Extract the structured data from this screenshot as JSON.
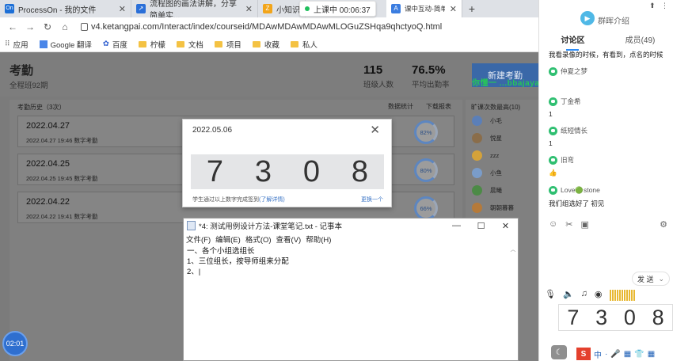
{
  "browser": {
    "tabs": [
      {
        "label": "ProcessOn - 我的文件",
        "fav_color": "#1d6fd6",
        "fav_text": "On"
      },
      {
        "label": "流程图的画法讲解，分享简单实...",
        "fav_color": "#2a6fd8",
        "fav_text": "↗"
      },
      {
        "label": "小知识",
        "fav_color": "#f2a51a",
        "fav_text": "Z"
      },
      {
        "label": "课中互动-简单好用的互动课堂...",
        "fav_color": "#3b7de0",
        "fav_text": "A"
      }
    ],
    "live_status": "上课中 00:06:37",
    "url": "v4.ketangpai.com/Interact/index/courseid/MDAwMDAwMDAwMLOGuZSHqa9qhctyoQ.html",
    "bookmarks": [
      "应用",
      "Google 翻译",
      "百度",
      "柠檬",
      "文档",
      "项目",
      "收藏",
      "私人"
    ]
  },
  "page": {
    "title": "考勤",
    "subtitle": "全程班92期",
    "stats": [
      {
        "value": "115",
        "label": "班级人数"
      },
      {
        "value": "76.5%",
        "label": "平均出勤率"
      }
    ],
    "new_button": "新建考勤",
    "watermark": "你懂一 ...bbajaya.com",
    "history_title": "考勤历史（3次）",
    "history_actions": [
      "数据统计",
      "下载报表"
    ],
    "records": [
      {
        "date": "2022.04.27",
        "sub": "2022.04.27  19:46    数字考勤",
        "rate": "82%"
      },
      {
        "date": "2022.04.25",
        "sub": "2022.04.25  19:45    数字考勤",
        "rate": "80%"
      },
      {
        "date": "2022.04.22",
        "sub": "2022.04.22  19:41    数字考勤",
        "rate": "66%"
      }
    ],
    "rank_title": "旷课次数最高(10)",
    "rank_items": [
      {
        "name": "小毛",
        "color": "#5b7fb8"
      },
      {
        "name": "悦星",
        "color": "#8a6d4a"
      },
      {
        "name": "zzz",
        "color": "#d4a23a"
      },
      {
        "name": "小鱼",
        "color": "#7a9cc9"
      },
      {
        "name": "晨曦",
        "color": "#4c8a46"
      },
      {
        "name": "朝朝暮暮",
        "color": "#b57a3a"
      }
    ]
  },
  "code_dialog": {
    "date": "2022.05.06",
    "digits": [
      "7",
      "3",
      "0",
      "8"
    ],
    "tip": "学生通过以上数字完成签到",
    "tip_link": "(了解详情)",
    "refresh": "更换一个"
  },
  "notepad": {
    "title": "*4: 测试用例设计方法-课堂笔记.txt - 记事本",
    "menu": [
      "文件(F)",
      "编辑(E)",
      "格式(O)",
      "查看(V)",
      "帮助(H)"
    ],
    "lines": [
      "一、各个小组选组长",
      "1、三位组长，按导师组来分配",
      "2、|"
    ]
  },
  "panel": {
    "logo_text": "群晖介绍",
    "tabs": [
      "讨论区",
      "成员(49)"
    ],
    "notice": "我看录像的时候，有看到，点名的时候",
    "messages": [
      {
        "name": "仲夏之梦",
        "text": ""
      },
      {
        "name": "丁金希",
        "text": "1"
      },
      {
        "name": "纸短情长",
        "text": "1"
      },
      {
        "name": "旧弯",
        "text": "👍"
      },
      {
        "name": "Love🟢stone",
        "text": "我们组选好了 初见"
      }
    ],
    "send_label": "发 送",
    "float_digits": [
      "7",
      "3",
      "0",
      "8"
    ]
  },
  "timer": "02:01",
  "ime_label": "中"
}
